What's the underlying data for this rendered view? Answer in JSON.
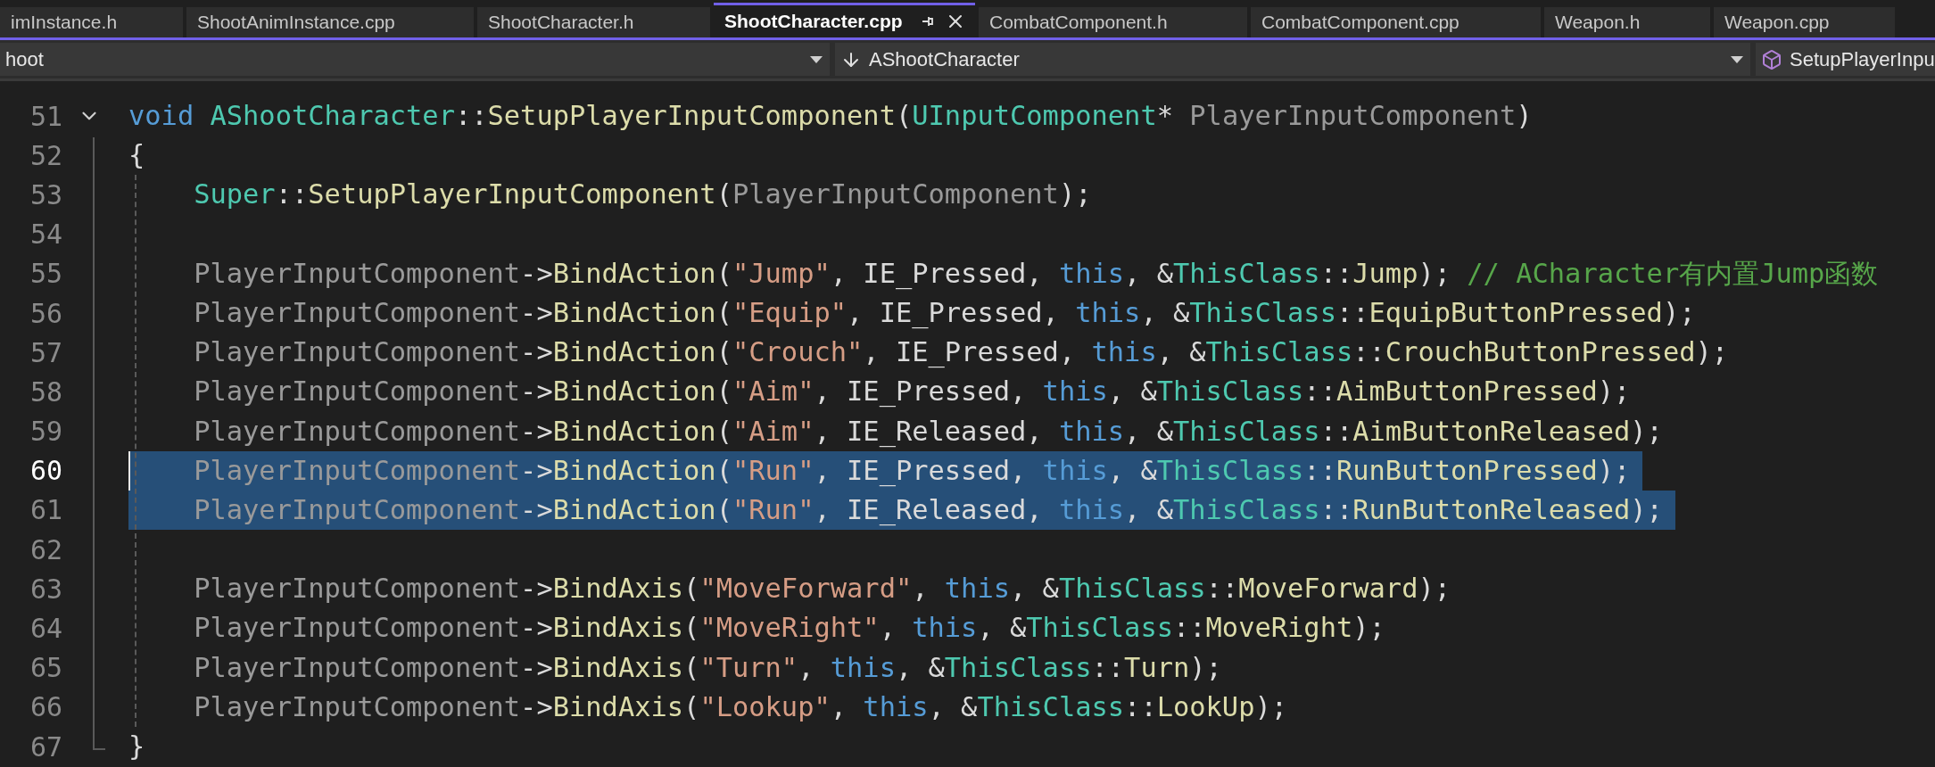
{
  "tabs": [
    {
      "label": "imInstance.h",
      "selected": false
    },
    {
      "label": "ShootAnimInstance.cpp",
      "selected": false
    },
    {
      "label": "ShootCharacter.h",
      "selected": false
    },
    {
      "label": "ShootCharacter.cpp",
      "selected": true
    },
    {
      "label": "CombatComponent.h",
      "selected": false
    },
    {
      "label": "CombatComponent.cpp",
      "selected": false
    },
    {
      "label": "Weapon.h",
      "selected": false
    },
    {
      "label": "Weapon.cpp",
      "selected": false
    }
  ],
  "navigation_bar": [
    {
      "kind": "project",
      "text": "hoot"
    },
    {
      "kind": "scope",
      "text": "AShootCharacter"
    },
    {
      "kind": "member",
      "text": "SetupPlayerInpu"
    }
  ],
  "lines": [
    {
      "number": "51",
      "selected": false,
      "current": false,
      "indented": false,
      "expanded": true,
      "tokens": [
        {
          "kind": "keyword",
          "text": "void"
        },
        {
          "kind": "type",
          "text": " AShootCharacter"
        },
        {
          "kind": "plain",
          "text": "::"
        },
        {
          "kind": "function",
          "text": "SetupPlayerInputComponent"
        },
        {
          "kind": "plain",
          "text": "("
        },
        {
          "kind": "type",
          "text": "UInputComponent"
        },
        {
          "kind": "plain",
          "text": "* "
        },
        {
          "kind": "param",
          "text": "PlayerInputComponent"
        },
        {
          "kind": "plain",
          "text": ")"
        }
      ]
    },
    {
      "number": "52",
      "selected": false,
      "current": false,
      "indented": false,
      "tokens": [
        {
          "kind": "plain",
          "text": "{"
        }
      ]
    },
    {
      "number": "53",
      "selected": false,
      "current": false,
      "indented": true,
      "tokens": [
        {
          "kind": "type",
          "text": "Super"
        },
        {
          "kind": "plain",
          "text": "::"
        },
        {
          "kind": "function",
          "text": "SetupPlayerInputComponent"
        },
        {
          "kind": "plain",
          "text": "("
        },
        {
          "kind": "param",
          "text": "PlayerInputComponent"
        },
        {
          "kind": "plain",
          "text": ");"
        }
      ]
    },
    {
      "number": "54",
      "current": false
    },
    {
      "number": "55",
      "selected": false,
      "current": false,
      "indented": true,
      "tokens": [
        {
          "kind": "param",
          "text": "PlayerInputComponent"
        },
        {
          "kind": "plain",
          "text": "->"
        },
        {
          "kind": "function",
          "text": "BindAction"
        },
        {
          "kind": "plain",
          "text": "("
        },
        {
          "kind": "string",
          "text": "\"Jump\""
        },
        {
          "kind": "plain",
          "text": ", IE_Pressed, "
        },
        {
          "kind": "keyword",
          "text": "this"
        },
        {
          "kind": "plain",
          "text": ", &"
        },
        {
          "kind": "type",
          "text": "ThisClass"
        },
        {
          "kind": "plain",
          "text": "::"
        },
        {
          "kind": "function",
          "text": "Jump"
        },
        {
          "kind": "plain",
          "text": "); "
        },
        {
          "kind": "comment",
          "text": "// ACharacter有内置Jump函数"
        }
      ]
    },
    {
      "number": "56",
      "selected": false,
      "current": false,
      "indented": true,
      "tokens": [
        {
          "kind": "param",
          "text": "PlayerInputComponent"
        },
        {
          "kind": "plain",
          "text": "->"
        },
        {
          "kind": "function",
          "text": "BindAction"
        },
        {
          "kind": "plain",
          "text": "("
        },
        {
          "kind": "string",
          "text": "\"Equip\""
        },
        {
          "kind": "plain",
          "text": ", IE_Pressed, "
        },
        {
          "kind": "keyword",
          "text": "this"
        },
        {
          "kind": "plain",
          "text": ", &"
        },
        {
          "kind": "type",
          "text": "ThisClass"
        },
        {
          "kind": "plain",
          "text": "::"
        },
        {
          "kind": "function",
          "text": "EquipButtonPressed"
        },
        {
          "kind": "plain",
          "text": ");"
        }
      ]
    },
    {
      "number": "57",
      "selected": false,
      "current": false,
      "indented": true,
      "tokens": [
        {
          "kind": "param",
          "text": "PlayerInputComponent"
        },
        {
          "kind": "plain",
          "text": "->"
        },
        {
          "kind": "function",
          "text": "BindAction"
        },
        {
          "kind": "plain",
          "text": "("
        },
        {
          "kind": "string",
          "text": "\"Crouch\""
        },
        {
          "kind": "plain",
          "text": ", IE_Pressed, "
        },
        {
          "kind": "keyword",
          "text": "this"
        },
        {
          "kind": "plain",
          "text": ", &"
        },
        {
          "kind": "type",
          "text": "ThisClass"
        },
        {
          "kind": "plain",
          "text": "::"
        },
        {
          "kind": "function",
          "text": "CrouchButtonPressed"
        },
        {
          "kind": "plain",
          "text": ");"
        }
      ]
    },
    {
      "number": "58",
      "selected": false,
      "current": false,
      "indented": true,
      "tokens": [
        {
          "kind": "param",
          "text": "PlayerInputComponent"
        },
        {
          "kind": "plain",
          "text": "->"
        },
        {
          "kind": "function",
          "text": "BindAction"
        },
        {
          "kind": "plain",
          "text": "("
        },
        {
          "kind": "string",
          "text": "\"Aim\""
        },
        {
          "kind": "plain",
          "text": ", IE_Pressed, "
        },
        {
          "kind": "keyword",
          "text": "this"
        },
        {
          "kind": "plain",
          "text": ", &"
        },
        {
          "kind": "type",
          "text": "ThisClass"
        },
        {
          "kind": "plain",
          "text": "::"
        },
        {
          "kind": "function",
          "text": "AimButtonPressed"
        },
        {
          "kind": "plain",
          "text": ");"
        }
      ]
    },
    {
      "number": "59",
      "selected": false,
      "current": false,
      "indented": true,
      "tokens": [
        {
          "kind": "param",
          "text": "PlayerInputComponent"
        },
        {
          "kind": "plain",
          "text": "->"
        },
        {
          "kind": "function",
          "text": "BindAction"
        },
        {
          "kind": "plain",
          "text": "("
        },
        {
          "kind": "string",
          "text": "\"Aim\""
        },
        {
          "kind": "plain",
          "text": ", IE_Released, "
        },
        {
          "kind": "keyword",
          "text": "this"
        },
        {
          "kind": "plain",
          "text": ", &"
        },
        {
          "kind": "type",
          "text": "ThisClass"
        },
        {
          "kind": "plain",
          "text": "::"
        },
        {
          "kind": "function",
          "text": "AimButtonReleased"
        },
        {
          "kind": "plain",
          "text": ");"
        }
      ]
    },
    {
      "number": "60",
      "selected": true,
      "current": true,
      "indented": true,
      "tokens": [
        {
          "kind": "param",
          "text": "PlayerInputComponent"
        },
        {
          "kind": "plain",
          "text": "->"
        },
        {
          "kind": "function",
          "text": "BindAction"
        },
        {
          "kind": "plain",
          "text": "("
        },
        {
          "kind": "string",
          "text": "\"Run\""
        },
        {
          "kind": "plain",
          "text": ", IE_Pressed, "
        },
        {
          "kind": "keyword",
          "text": "this"
        },
        {
          "kind": "plain",
          "text": ", &"
        },
        {
          "kind": "type",
          "text": "ThisClass"
        },
        {
          "kind": "plain",
          "text": "::"
        },
        {
          "kind": "function",
          "text": "RunButtonPressed"
        },
        {
          "kind": "plain",
          "text": ");"
        }
      ]
    },
    {
      "number": "61",
      "selected": true,
      "current": false,
      "indented": true,
      "tokens": [
        {
          "kind": "param",
          "text": "PlayerInputComponent"
        },
        {
          "kind": "plain",
          "text": "->"
        },
        {
          "kind": "function",
          "text": "BindAction"
        },
        {
          "kind": "plain",
          "text": "("
        },
        {
          "kind": "string",
          "text": "\"Run\""
        },
        {
          "kind": "plain",
          "text": ", IE_Released, "
        },
        {
          "kind": "keyword",
          "text": "this"
        },
        {
          "kind": "plain",
          "text": ", &"
        },
        {
          "kind": "type",
          "text": "ThisClass"
        },
        {
          "kind": "plain",
          "text": "::"
        },
        {
          "kind": "function",
          "text": "RunButtonReleased"
        },
        {
          "kind": "plain",
          "text": ");"
        }
      ]
    },
    {
      "number": "62",
      "current": false
    },
    {
      "number": "63",
      "selected": false,
      "current": false,
      "indented": true,
      "tokens": [
        {
          "kind": "param",
          "text": "PlayerInputComponent"
        },
        {
          "kind": "plain",
          "text": "->"
        },
        {
          "kind": "function",
          "text": "BindAxis"
        },
        {
          "kind": "plain",
          "text": "("
        },
        {
          "kind": "string",
          "text": "\"MoveForward\""
        },
        {
          "kind": "plain",
          "text": ", "
        },
        {
          "kind": "keyword",
          "text": "this"
        },
        {
          "kind": "plain",
          "text": ", &"
        },
        {
          "kind": "type",
          "text": "ThisClass"
        },
        {
          "kind": "plain",
          "text": "::"
        },
        {
          "kind": "function",
          "text": "MoveForward"
        },
        {
          "kind": "plain",
          "text": ");"
        }
      ]
    },
    {
      "number": "64",
      "selected": false,
      "current": false,
      "indented": true,
      "tokens": [
        {
          "kind": "param",
          "text": "PlayerInputComponent"
        },
        {
          "kind": "plain",
          "text": "->"
        },
        {
          "kind": "function",
          "text": "BindAxis"
        },
        {
          "kind": "plain",
          "text": "("
        },
        {
          "kind": "string",
          "text": "\"MoveRight\""
        },
        {
          "kind": "plain",
          "text": ", "
        },
        {
          "kind": "keyword",
          "text": "this"
        },
        {
          "kind": "plain",
          "text": ", &"
        },
        {
          "kind": "type",
          "text": "ThisClass"
        },
        {
          "kind": "plain",
          "text": "::"
        },
        {
          "kind": "function",
          "text": "MoveRight"
        },
        {
          "kind": "plain",
          "text": ");"
        }
      ]
    },
    {
      "number": "65",
      "selected": false,
      "current": false,
      "indented": true,
      "tokens": [
        {
          "kind": "param",
          "text": "PlayerInputComponent"
        },
        {
          "kind": "plain",
          "text": "->"
        },
        {
          "kind": "function",
          "text": "BindAxis"
        },
        {
          "kind": "plain",
          "text": "("
        },
        {
          "kind": "string",
          "text": "\"Turn\""
        },
        {
          "kind": "plain",
          "text": ", "
        },
        {
          "kind": "keyword",
          "text": "this"
        },
        {
          "kind": "plain",
          "text": ", &"
        },
        {
          "kind": "type",
          "text": "ThisClass"
        },
        {
          "kind": "plain",
          "text": "::"
        },
        {
          "kind": "function",
          "text": "Turn"
        },
        {
          "kind": "plain",
          "text": ");"
        }
      ]
    },
    {
      "number": "66",
      "selected": false,
      "current": false,
      "indented": true,
      "tokens": [
        {
          "kind": "param",
          "text": "PlayerInputComponent"
        },
        {
          "kind": "plain",
          "text": "->"
        },
        {
          "kind": "function",
          "text": "BindAxis"
        },
        {
          "kind": "plain",
          "text": "("
        },
        {
          "kind": "string",
          "text": "\"Lookup\""
        },
        {
          "kind": "plain",
          "text": ", "
        },
        {
          "kind": "keyword",
          "text": "this"
        },
        {
          "kind": "plain",
          "text": ", &"
        },
        {
          "kind": "type",
          "text": "ThisClass"
        },
        {
          "kind": "plain",
          "text": "::"
        },
        {
          "kind": "function",
          "text": "LookUp"
        },
        {
          "kind": "plain",
          "text": ");"
        }
      ]
    },
    {
      "number": "67",
      "selected": false,
      "current": false,
      "indented": false,
      "tokens": [
        {
          "kind": "plain",
          "text": "}"
        }
      ]
    }
  ]
}
